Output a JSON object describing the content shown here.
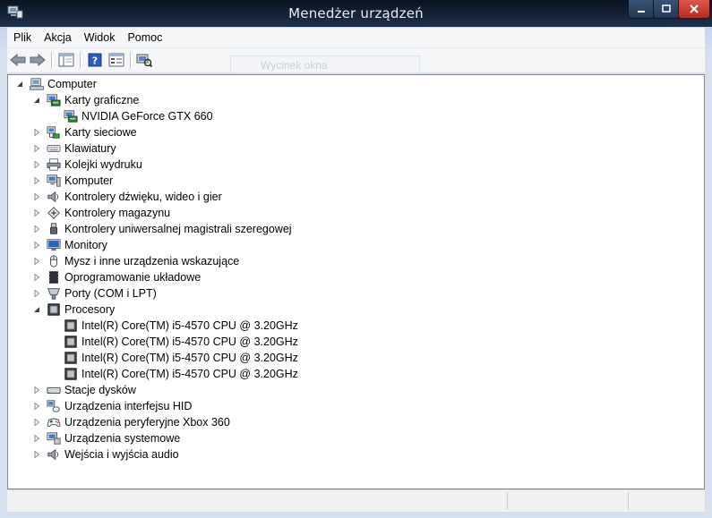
{
  "window": {
    "title": "Menedżer urządzeń"
  },
  "menu": {
    "items": [
      "Plik",
      "Akcja",
      "Widok",
      "Pomoc"
    ]
  },
  "toolbar": {
    "ghost_tooltip": "Wycinek okna"
  },
  "tree": {
    "root": "Computer",
    "nodes": [
      {
        "label": "Karty graficzne",
        "expanded": true,
        "icon": "display-adapter-icon"
      },
      {
        "label": "NVIDIA GeForce GTX 660",
        "child": true,
        "icon": "display-adapter-icon"
      },
      {
        "label": "Karty sieciowe",
        "icon": "network-adapter-icon"
      },
      {
        "label": "Klawiatury",
        "icon": "keyboard-icon"
      },
      {
        "label": "Kolejki wydruku",
        "icon": "printer-icon"
      },
      {
        "label": "Komputer",
        "icon": "computer-icon"
      },
      {
        "label": "Kontrolery dźwięku, wideo i gier",
        "icon": "speaker-icon"
      },
      {
        "label": "Kontrolery magazynu",
        "icon": "storage-controller-icon"
      },
      {
        "label": "Kontrolery uniwersalnej magistrali szeregowej",
        "icon": "usb-icon"
      },
      {
        "label": "Monitory",
        "icon": "monitor-icon"
      },
      {
        "label": "Mysz i inne urządzenia wskazujące",
        "icon": "mouse-icon"
      },
      {
        "label": "Oprogramowanie układowe",
        "icon": "firmware-icon"
      },
      {
        "label": "Porty (COM i LPT)",
        "icon": "port-icon"
      },
      {
        "label": "Procesory",
        "expanded": true,
        "icon": "processor-icon"
      },
      {
        "label": "Intel(R) Core(TM) i5-4570 CPU @ 3.20GHz",
        "child": true,
        "icon": "processor-icon"
      },
      {
        "label": "Intel(R) Core(TM) i5-4570 CPU @ 3.20GHz",
        "child": true,
        "icon": "processor-icon"
      },
      {
        "label": "Intel(R) Core(TM) i5-4570 CPU @ 3.20GHz",
        "child": true,
        "icon": "processor-icon"
      },
      {
        "label": "Intel(R) Core(TM) i5-4570 CPU @ 3.20GHz",
        "child": true,
        "icon": "processor-icon"
      },
      {
        "label": "Stacje dysków",
        "icon": "disk-drive-icon"
      },
      {
        "label": "Urządzenia interfejsu HID",
        "icon": "hid-icon"
      },
      {
        "label": "Urządzenia peryferyjne Xbox 360",
        "icon": "gamepad-icon"
      },
      {
        "label": "Urządzenia systemowe",
        "icon": "system-device-icon"
      },
      {
        "label": "Wejścia i wyjścia audio",
        "icon": "audio-io-icon"
      }
    ]
  }
}
